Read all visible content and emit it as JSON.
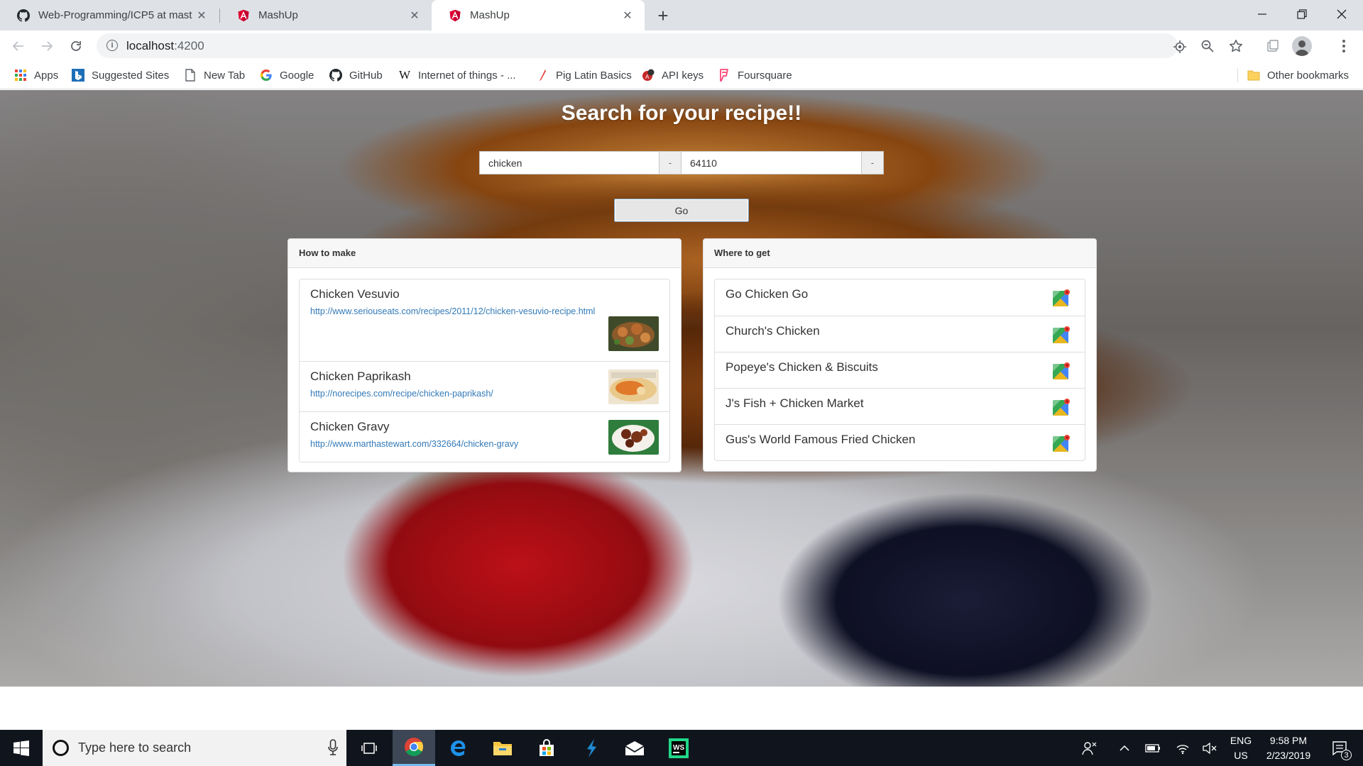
{
  "browser": {
    "tabs": [
      {
        "title": "Web-Programming/ICP5 at mast",
        "icon": "github-icon",
        "active": false
      },
      {
        "title": "MashUp",
        "icon": "angular-icon",
        "active": false
      },
      {
        "title": "MashUp",
        "icon": "angular-icon",
        "active": true
      }
    ],
    "new_tab": "+",
    "url_host": "localhost",
    "url_port": ":4200",
    "bookmarks": [
      {
        "label": "Apps",
        "icon": "apps-grid-icon"
      },
      {
        "label": "Suggested Sites",
        "icon": "bing-icon"
      },
      {
        "label": "New Tab",
        "icon": "page-icon"
      },
      {
        "label": "Google",
        "icon": "google-icon"
      },
      {
        "label": "GitHub",
        "icon": "github-icon"
      },
      {
        "label": "Internet of things - ...",
        "icon": "wikipedia-icon"
      },
      {
        "label": "Pig Latin Basics",
        "icon": "pen-icon"
      },
      {
        "label": "API keys",
        "icon": "api-icon"
      },
      {
        "label": "Foursquare",
        "icon": "foursquare-icon"
      }
    ],
    "other_bookmarks": "Other bookmarks"
  },
  "page": {
    "title": "Search for your recipe!!",
    "search": {
      "recipe_value": "chicken",
      "recipe_addon": "-",
      "zip_value": "64110",
      "zip_addon": "-"
    },
    "go_label": "Go",
    "how_to_make": {
      "heading": "How to make",
      "recipes": [
        {
          "name": "Chicken Vesuvio",
          "url": "http://www.seriouseats.com/recipes/2011/12/chicken-vesuvio-recipe.html"
        },
        {
          "name": "Chicken Paprikash",
          "url": "http://norecipes.com/recipe/chicken-paprikash/"
        },
        {
          "name": "Chicken Gravy",
          "url": "http://www.marthastewart.com/332664/chicken-gravy"
        }
      ]
    },
    "where_to_get": {
      "heading": "Where to get",
      "places": [
        "Go Chicken Go",
        "Church's Chicken",
        "Popeye's Chicken & Biscuits",
        "J's Fish + Chicken Market",
        "Gus's World Famous Fried Chicken"
      ]
    }
  },
  "taskbar": {
    "search_placeholder": "Type here to search",
    "lang_top": "ENG",
    "lang_bottom": "US",
    "time": "9:58 PM",
    "date": "2/23/2019",
    "notification_count": "3"
  },
  "colors": {
    "link": "#337ab7",
    "taskbar": "#10151d",
    "tab_strip": "#dee1e6"
  }
}
